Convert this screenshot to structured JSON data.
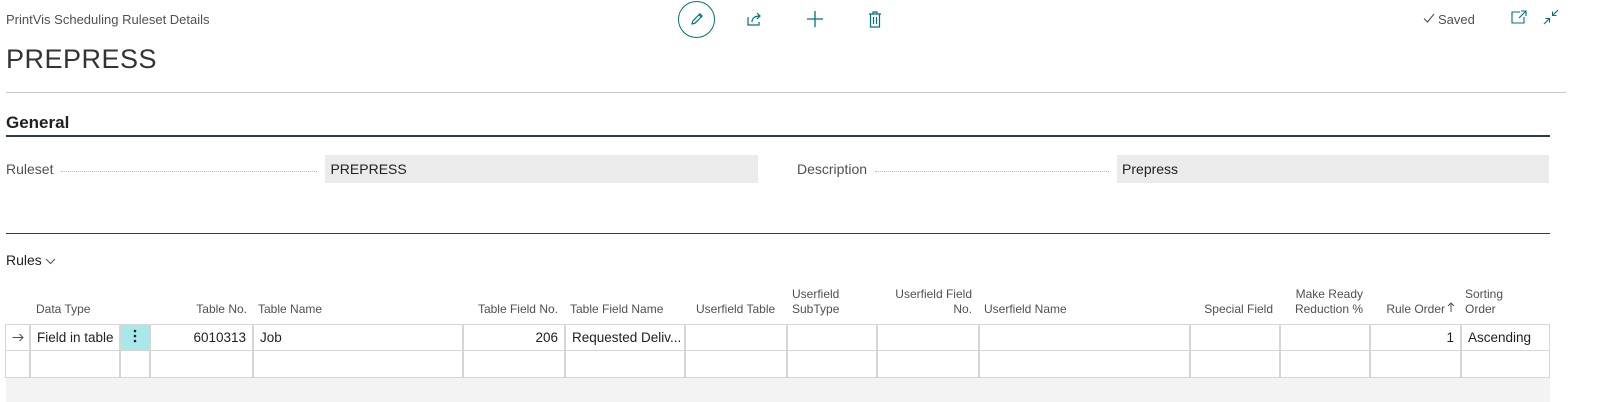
{
  "page": {
    "caption": "PrintVis Scheduling Ruleset Details",
    "title": "PREPRESS",
    "saved_label": "Saved"
  },
  "actions": {
    "icons": [
      "pencil-icon",
      "share-icon",
      "plus-icon",
      "trash-icon"
    ]
  },
  "general": {
    "heading": "General",
    "ruleset_label": "Ruleset",
    "ruleset_value": "PREPRESS",
    "description_label": "Description",
    "description_value": "Prepress"
  },
  "rules": {
    "heading": "Rules",
    "columns": {
      "data_type": "Data Type",
      "table_no": "Table No.",
      "table_name": "Table Name",
      "table_field_no": "Table Field No.",
      "table_field_name": "Table Field Name",
      "userfield_table": "Userfield Table",
      "userfield_subtype_1": "Userfield",
      "userfield_subtype_2": "SubType",
      "userfield_field_no_1": "Userfield Field",
      "userfield_field_no_2": "No.",
      "userfield_name": "Userfield Name",
      "special_field": "Special Field",
      "make_ready_1": "Make Ready",
      "make_ready_2": "Reduction %",
      "rule_order": "Rule Order",
      "sorting_order_1": "Sorting",
      "sorting_order_2": "Order"
    },
    "rows": [
      {
        "data_type": "Field in table",
        "table_no": "6010313",
        "table_name": "Job",
        "table_field_no": "206",
        "table_field_name": "Requested Deliv...",
        "userfield_table": "",
        "userfield_subtype": "",
        "userfield_field_no": "",
        "userfield_name": "",
        "special_field": "",
        "make_ready_reduction": "",
        "rule_order": "1",
        "sorting_order": "Ascending"
      }
    ]
  },
  "colors": {
    "accent": "#00747a",
    "selected_menu_cell": "#a9e8ea",
    "field_bg": "#ebebeb"
  }
}
